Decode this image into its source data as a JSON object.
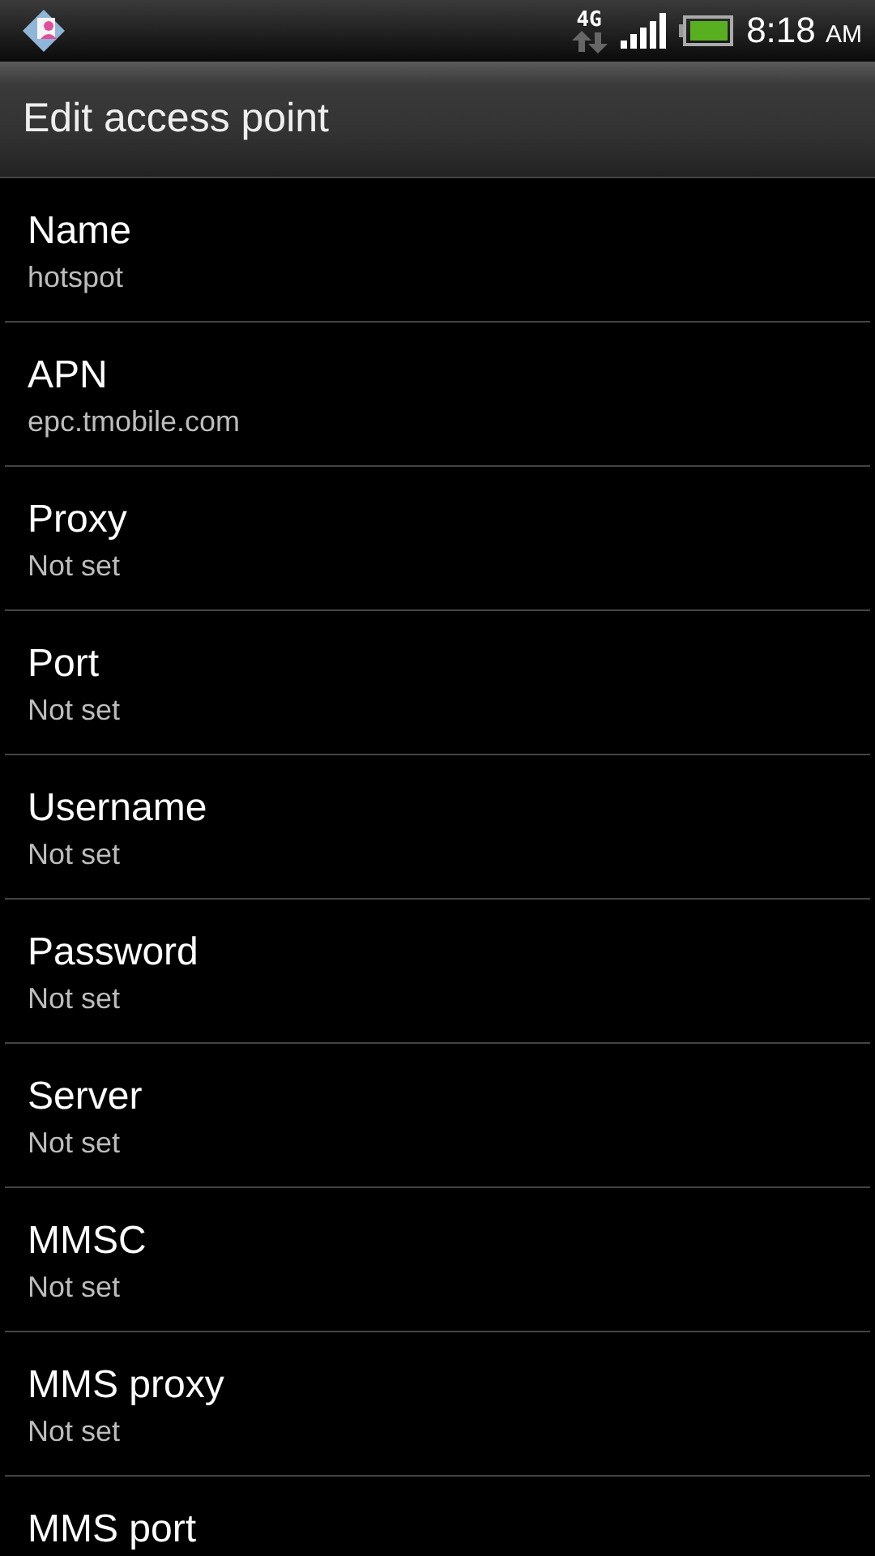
{
  "status_bar": {
    "network": "4G",
    "time": "8:18",
    "meridiem": "AM"
  },
  "title": "Edit access point",
  "settings": [
    {
      "label": "Name",
      "value": "hotspot"
    },
    {
      "label": "APN",
      "value": "epc.tmobile.com"
    },
    {
      "label": "Proxy",
      "value": "Not set"
    },
    {
      "label": "Port",
      "value": "Not set"
    },
    {
      "label": "Username",
      "value": "Not set"
    },
    {
      "label": "Password",
      "value": "Not set"
    },
    {
      "label": "Server",
      "value": "Not set"
    },
    {
      "label": "MMSC",
      "value": "Not set"
    },
    {
      "label": "MMS proxy",
      "value": "Not set"
    },
    {
      "label": "MMS port"
    }
  ]
}
